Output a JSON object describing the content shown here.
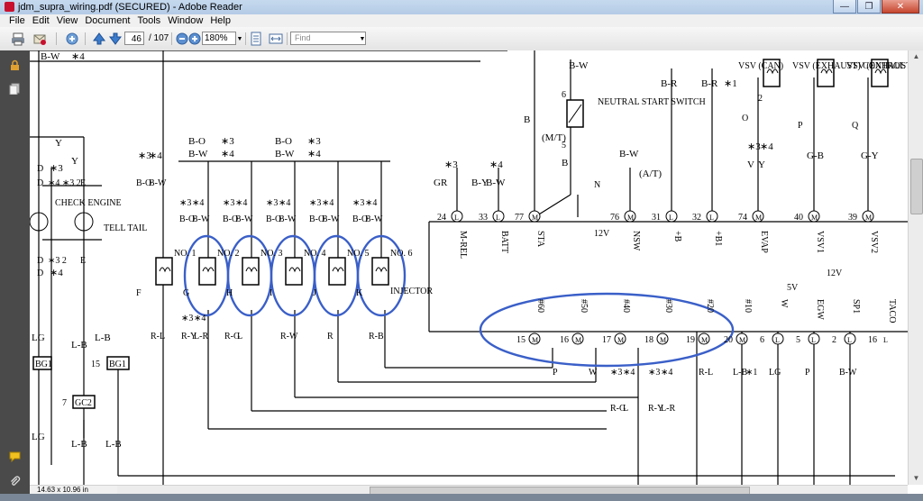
{
  "window": {
    "title": "jdm_supra_wiring.pdf (SECURED) - Adobe Reader",
    "minimize_label": "—",
    "restore_label": "❐",
    "close_label": "✕"
  },
  "menu": [
    "File",
    "Edit",
    "View",
    "Document",
    "Tools",
    "Window",
    "Help"
  ],
  "toolbar": {
    "page_number": "46",
    "page_count": "/ 107",
    "zoom": "180%",
    "find_placeholder": "Find"
  },
  "status": {
    "page_size": "14.63 x 10.96 in"
  },
  "colors": {
    "annotation": "#3a5fc8",
    "accent": "#c8102e"
  },
  "diagram": {
    "top_labels": {
      "bw_top": "B-W",
      "bw_top_star": "∗4",
      "bo1": "B-O",
      "bw1": "B-W",
      "bo2": "B-O",
      "bw2": "B-W",
      "s3a": "∗3",
      "s4a": "∗4",
      "s3b": "∗3",
      "s4b": "∗4",
      "s3c": "∗3",
      "s4c": "∗4",
      "b_mt": "B",
      "mt": "(M/T)",
      "b_low": "B",
      "bw_nss": "B-W",
      "nss": "NEUTRAL START SWITCH",
      "n_circle": "N",
      "bw_at": "B-W",
      "at": "(A/T)",
      "br1": "B-R",
      "br2": "B-R",
      "star1": "∗1",
      "vsv_can": "VSV (CAN)",
      "o_circle": "O",
      "vsv_exh": "VSV (EXHAUST) CONTROL V",
      "p_circle": "P",
      "vsv_exh2": "VSV (EXHAUST) CONTROL V",
      "q_circle": "Q",
      "v_y": "V",
      "y_y": "Y",
      "s3v": "∗3",
      "s4v": "∗4",
      "gb": "G-B",
      "gy": "G-Y",
      "gr": "GR",
      "by": "B-Y",
      "bw_batt": "B-W",
      "s3g": "∗3",
      "s4g": "∗4",
      "pin6": "6",
      "pin5": "5",
      "pin2": "2"
    },
    "left_labels": {
      "y1": "Y",
      "d1": "D",
      "s3": "∗3",
      "y2": "Y",
      "d2": "D",
      "s43": "∗4 ∗3 2",
      "e1": "E",
      "check_engine": "CHECK ENGINE",
      "tell_tail": "TELL TAIL",
      "d3": "D",
      "s32": "∗3 2",
      "e2": "E",
      "d4": "D",
      "s4": "∗4",
      "lg1": "LG",
      "lb1": "L-B",
      "lb2": "L-B",
      "bg1a": "BG1",
      "bg1b": "BG1",
      "n15": "15",
      "n7": "7",
      "gc2": "GC2",
      "lg2": "LG",
      "lb3": "L-B",
      "lb4": "L-B"
    },
    "injectors": {
      "no1": "NO. 1",
      "no2": "NO. 2",
      "no3": "NO. 3",
      "no4": "NO. 4",
      "no5": "NO. 5",
      "no6": "NO. 6",
      "injector": "INJECTOR",
      "f": "F",
      "g": "G",
      "h": "H",
      "i": "I",
      "j": "J",
      "k": "K",
      "bo": "B-O",
      "bw": "B-W",
      "s3": "∗3",
      "s4": "∗4",
      "bo_b": "B-O",
      "bw_b": "B-W",
      "s3_b": "∗3",
      "s4_b": "∗4",
      "bo_c": "B-O",
      "bw_c": "B-W",
      "s3_c": "∗3",
      "s4_c": "∗4",
      "bo_d": "B-O",
      "bw_d": "B-W",
      "s3_d": "∗3",
      "s4_d": "∗4",
      "bo_e": "B-O",
      "bw_e": "B-W",
      "s3_e": "∗3",
      "s4_e": "∗4",
      "bw_f1": "B-O",
      "bw_f2": "B-W",
      "rl": "R-L",
      "ry": "R-Y",
      "lr": "L-R",
      "s3r": "∗3",
      "s4r": "∗4",
      "rg": "R-G",
      "l": "L",
      "rw": "R-W",
      "r": "R",
      "rb": "R-B"
    },
    "ecu_top_pins": [
      {
        "num": "24",
        "letter": "L",
        "wire": "M-REL"
      },
      {
        "num": "33",
        "letter": "L",
        "wire": "BATT"
      },
      {
        "num": "77",
        "letter": "M",
        "wire": "STA"
      },
      {
        "num": "76",
        "letter": "M",
        "wire": "NSW"
      },
      {
        "num": "31",
        "letter": "L",
        "wire": "+B"
      },
      {
        "num": "32",
        "letter": "L",
        "wire": "+B1"
      },
      {
        "num": "74",
        "letter": "M",
        "wire": "EVAP"
      },
      {
        "num": "40",
        "letter": "M",
        "wire": "VSV1"
      },
      {
        "num": "39",
        "letter": "M",
        "wire": "VSV2"
      }
    ],
    "ecu_bottom_pins": [
      {
        "num": "15",
        "letter": "M",
        "wire": "#60"
      },
      {
        "num": "16",
        "letter": "M",
        "wire": "#50"
      },
      {
        "num": "17",
        "letter": "M",
        "wire": "#40"
      },
      {
        "num": "18",
        "letter": "M",
        "wire": "#30"
      },
      {
        "num": "19",
        "letter": "M",
        "wire": "#20"
      },
      {
        "num": "20",
        "letter": "M",
        "wire": "#10"
      },
      {
        "num": "6",
        "letter": "L",
        "wire": "W"
      },
      {
        "num": "5",
        "letter": "L",
        "wire": "EGW"
      },
      {
        "num": "2",
        "letter": "L",
        "wire": "SP1"
      },
      {
        "num": "16",
        "letter": "L",
        "wire": "TACO"
      }
    ],
    "ecu_misc": {
      "v12a": "12V",
      "v12b": "12V",
      "v5": "5V"
    },
    "bottom_wires": {
      "p": "P",
      "w": "W",
      "rg": "R-G",
      "l": "L",
      "s3": "∗3",
      "s4": "∗4",
      "ry": "R-Y",
      "lr": "L-R",
      "s3b": "∗3",
      "s4b": "∗4",
      "rl": "R-L",
      "lb": "L-B",
      "star1": "∗1",
      "lg": "LG",
      "p2": "P",
      "bw": "B-W"
    }
  }
}
